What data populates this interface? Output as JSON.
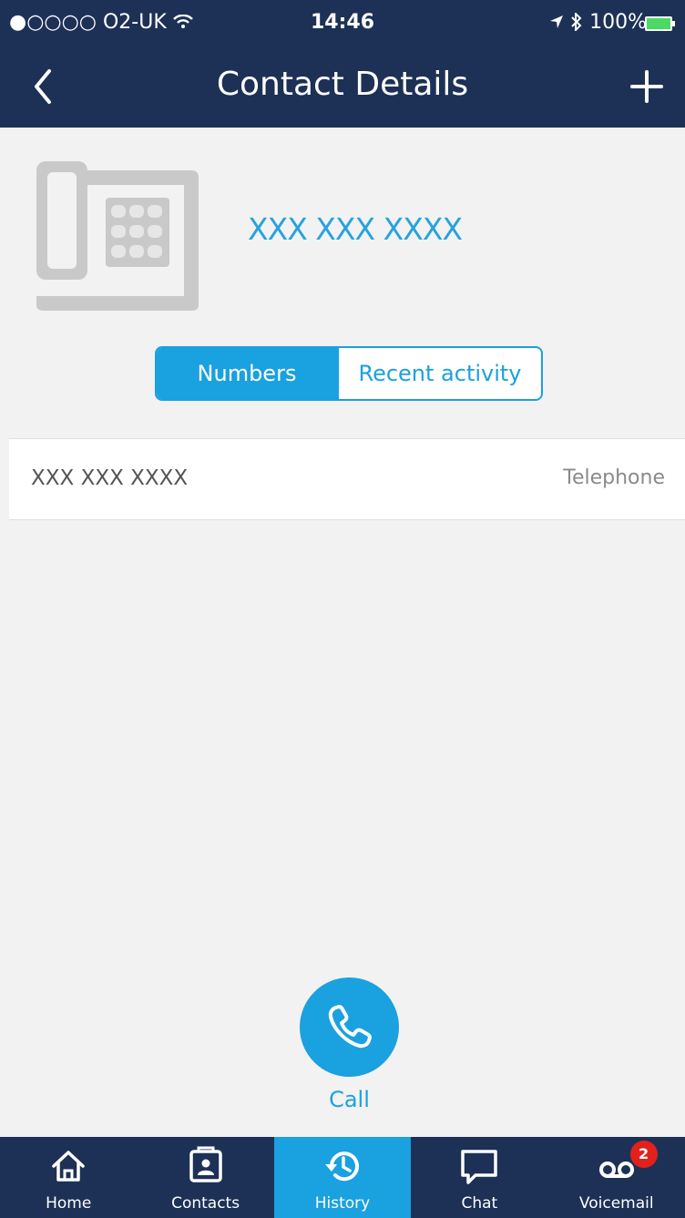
{
  "status_bar": {
    "carrier": "●○○○○ O2-UK",
    "time": "14:46",
    "battery": "100%",
    "wifi_icon": "wifi-icon",
    "location_icon": "location-arrow-icon",
    "bluetooth_icon": "bluetooth-icon"
  },
  "header": {
    "title": "Contact Details",
    "back_icon": "chevron-left-icon",
    "add_icon": "plus-icon"
  },
  "contact": {
    "name": "XXX XXX XXXX",
    "avatar_icon": "desk-phone-icon"
  },
  "segments": {
    "numbers_label": "Numbers",
    "recent_label": "Recent activity",
    "active": "Numbers"
  },
  "numbers": [
    {
      "value": "XXX XXX XXXX",
      "type": "Telephone"
    }
  ],
  "call": {
    "label": "Call",
    "icon": "phone-handset-icon"
  },
  "tabbar": {
    "items": [
      {
        "label": "Home",
        "icon": "home-icon"
      },
      {
        "label": "Contacts",
        "icon": "contacts-icon"
      },
      {
        "label": "History",
        "icon": "history-icon",
        "active": true
      },
      {
        "label": "Chat",
        "icon": "chat-bubble-icon"
      },
      {
        "label": "Voicemail",
        "icon": "voicemail-icon",
        "badge": "2"
      }
    ]
  },
  "colors": {
    "navy": "#1d3156",
    "accent": "#1aa1df",
    "badge": "#e2211c",
    "background": "#f2f2f2"
  }
}
